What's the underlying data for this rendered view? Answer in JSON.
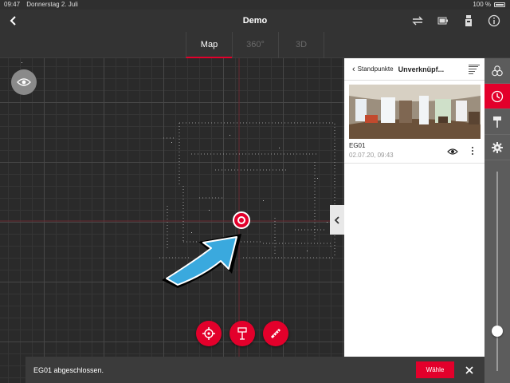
{
  "statusbar": {
    "time": "09:47",
    "date": "Donnerstag 2. Juli",
    "battery": "100 %"
  },
  "header": {
    "title": "Demo"
  },
  "tabs": [
    {
      "label": "Map",
      "active": true
    },
    {
      "label": "360°",
      "active": false
    },
    {
      "label": "3D",
      "active": false
    }
  ],
  "panel": {
    "back_label": "Standpunkte",
    "title": "Unverknüpf...",
    "items": [
      {
        "name": "EG01",
        "date": "02.07.20, 09:43"
      }
    ]
  },
  "toast": {
    "message": "EG01 abgeschlossen.",
    "action_label": "Wähle"
  },
  "slider": {
    "value_fraction": 0.2
  },
  "colors": {
    "accent": "#e3002b",
    "toolbar": "#5c5c5c",
    "background": "#2b2b2b",
    "arrow": "#3aa9de"
  },
  "icons": {
    "back": "chevron-left-icon",
    "top": [
      "swap-icon",
      "battery-icon",
      "device-icon",
      "info-icon"
    ],
    "fabs": [
      "target-icon",
      "pin-icon",
      "measure-icon"
    ],
    "rtoolbar": [
      "layers-icon",
      "station-icon",
      "pin-icon",
      "gear-icon"
    ]
  }
}
